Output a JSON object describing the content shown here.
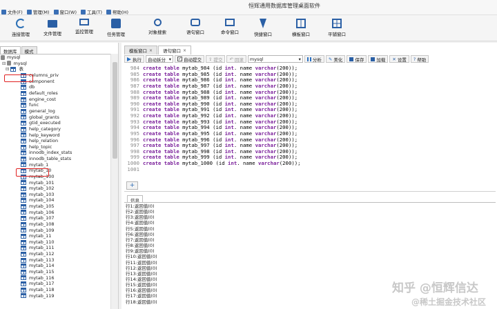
{
  "window": {
    "title": "恒辉通用数据库管理桌面软件"
  },
  "menu": [
    {
      "label": "文件(F)",
      "icon": "file-icon",
      "color": "#3a6fb5"
    },
    {
      "label": "管理(M)",
      "icon": "gear-icon",
      "color": "#3a6fb5"
    },
    {
      "label": "窗口(W)",
      "icon": "window-icon",
      "color": "#3a6fb5"
    },
    {
      "label": "工具(T)",
      "icon": "tools-icon",
      "color": "#3a6fb5"
    },
    {
      "label": "帮助(H)",
      "icon": "help-icon",
      "color": "#3a6fb5"
    }
  ],
  "toolbar": [
    {
      "label": "连接管理",
      "icon": "refresh-icon"
    },
    {
      "label": "文件管理",
      "icon": "folder-icon"
    },
    {
      "label": "监控管理",
      "icon": "monitor-icon"
    },
    {
      "label": "任务管理",
      "icon": "calendar-icon"
    },
    {
      "label": "对象搜索",
      "icon": "search-icon"
    },
    {
      "label": "语句窗口",
      "icon": "chat-icon"
    },
    {
      "label": "命令窗口",
      "icon": "terminal-icon"
    },
    {
      "label": "快捷窗口",
      "icon": "lightning-icon"
    },
    {
      "label": "横板窗口",
      "icon": "layout-h-icon"
    },
    {
      "label": "平铺窗口",
      "icon": "grid-icon"
    }
  ],
  "left_tabs": [
    "数据库",
    "模式"
  ],
  "tree": {
    "root": "mysql",
    "db": "mysql",
    "tables_node": "表",
    "tables": [
      "columns_priv",
      "component",
      "db",
      "default_roles",
      "engine_cost",
      "func",
      "general_log",
      "global_grants",
      "gtid_executed",
      "help_category",
      "help_keyword",
      "help_relation",
      "help_topic",
      "innodb_index_stats",
      "innodb_table_stats",
      "mytab_1",
      "mytab_10",
      "mytab_100",
      "mytab_101",
      "mytab_102",
      "mytab_103",
      "mytab_104",
      "mytab_105",
      "mytab_106",
      "mytab_107",
      "mytab_108",
      "mytab_109",
      "mytab_11",
      "mytab_110",
      "mytab_111",
      "mytab_112",
      "mytab_113",
      "mytab_114",
      "mytab_115",
      "mytab_116",
      "mytab_117",
      "mytab_118",
      "mytab_119"
    ]
  },
  "right_tabs": [
    {
      "label": "模板窗口",
      "active": false
    },
    {
      "label": "语句窗口",
      "active": true
    }
  ],
  "editor_toolbar": {
    "execute": "执行",
    "auto_split": "自动拆分",
    "auto_commit": "自动提交",
    "commit": "提交",
    "rollback": "回滚",
    "connection": "mysql",
    "analyze": "分析",
    "beautify": "美化",
    "save": "保存",
    "load": "加载",
    "settings": "设置",
    "help": "帮助"
  },
  "editor": {
    "keywords": {
      "create": "create",
      "table": "table",
      "varchar": "varchar"
    },
    "lines": [
      {
        "n": "984",
        "name": "mytab_984"
      },
      {
        "n": "985",
        "name": "mytab_985"
      },
      {
        "n": "986",
        "name": "mytab_986"
      },
      {
        "n": "987",
        "name": "mytab_987"
      },
      {
        "n": "988",
        "name": "mytab_988"
      },
      {
        "n": "989",
        "name": "mytab_989"
      },
      {
        "n": "990",
        "name": "mytab_990"
      },
      {
        "n": "991",
        "name": "mytab_991"
      },
      {
        "n": "992",
        "name": "mytab_992"
      },
      {
        "n": "993",
        "name": "mytab_993"
      },
      {
        "n": "994",
        "name": "mytab_994"
      },
      {
        "n": "995",
        "name": "mytab_995"
      },
      {
        "n": "996",
        "name": "mytab_996"
      },
      {
        "n": "997",
        "name": "mytab_997"
      },
      {
        "n": "998",
        "name": "mytab_998"
      },
      {
        "n": "999",
        "name": "mytab_999"
      },
      {
        "n": "1000",
        "name": "mytab_1000"
      }
    ],
    "col_text_1": " (id ",
    "int_kw": "int",
    "col_text_2": ". name ",
    "tail": "(200));",
    "last_line_no": "1001"
  },
  "add_button": "+",
  "info_tab": "信息",
  "info_lines": [
    "行1:返回值(0)",
    "行2:返回值(0)",
    "行3:返回值(0)",
    "行4:返回值(0)",
    "行5:返回值(0)",
    "行6:返回值(0)",
    "行7:返回值(0)",
    "行8:返回值(0)",
    "行9:返回值(0)",
    "行10:返回值(0)",
    "行11:返回值(0)",
    "行12:返回值(0)",
    "行13:返回值(0)",
    "行14:返回值(0)",
    "行15:返回值(0)",
    "行16:返回值(0)",
    "行17:返回值(0)",
    "行18:返回值(0)"
  ],
  "watermark": {
    "line1": "知乎 @恒辉信达",
    "line2": "@稀土掘金技术社区"
  }
}
